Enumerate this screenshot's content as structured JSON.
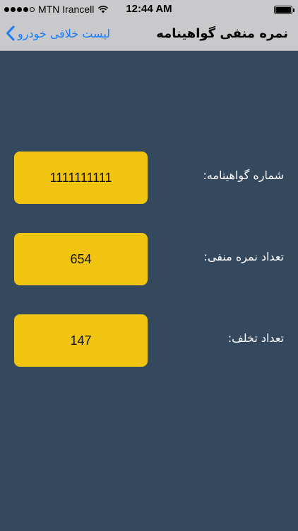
{
  "status_bar": {
    "carrier": "MTN Irancell",
    "time": "12:44 AM"
  },
  "nav": {
    "back_label": "لیست خلافی خودرو",
    "title": "نمره منفی گواهینامه"
  },
  "fields": [
    {
      "label": "شماره گواهینامه:",
      "value": "1111111111"
    },
    {
      "label": "تعداد نمره منفی:",
      "value": "654"
    },
    {
      "label": "تعداد تخلف:",
      "value": "147"
    }
  ]
}
